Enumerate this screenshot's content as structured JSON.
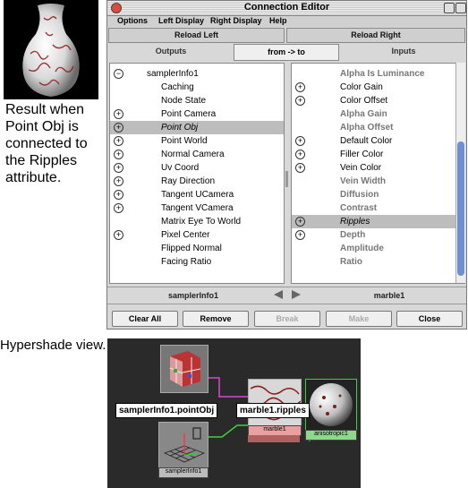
{
  "caption": {
    "lines": [
      "Result when",
      "Point Obj is",
      "connected to",
      "the Ripples",
      "attribute."
    ]
  },
  "window": {
    "title": "Connection Editor",
    "menu": [
      "Options",
      "Left Display",
      "Right Display",
      "Help"
    ],
    "reload_left": "Reload Left",
    "reload_right": "Reload Right",
    "outputs_label": "Outputs",
    "inputs_label": "Inputs",
    "direction_button": "from -> to",
    "left_node": "samplerInfo1",
    "right_node": "marble1",
    "outputs": [
      {
        "label": "samplerInfo1",
        "expander": "minus",
        "indent": 0
      },
      {
        "label": "Caching",
        "expander": "",
        "indent": 1
      },
      {
        "label": "Node State",
        "expander": "",
        "indent": 1
      },
      {
        "label": "Point Camera",
        "expander": "plus",
        "indent": 1
      },
      {
        "label": "Point Obj",
        "expander": "plus",
        "indent": 1,
        "selected": true
      },
      {
        "label": "Point World",
        "expander": "plus",
        "indent": 1
      },
      {
        "label": "Normal Camera",
        "expander": "plus",
        "indent": 1
      },
      {
        "label": "Uv Coord",
        "expander": "plus",
        "indent": 1
      },
      {
        "label": "Ray Direction",
        "expander": "plus",
        "indent": 1
      },
      {
        "label": "Tangent UCamera",
        "expander": "plus",
        "indent": 1
      },
      {
        "label": "Tangent VCamera",
        "expander": "plus",
        "indent": 1
      },
      {
        "label": "Matrix Eye To World",
        "expander": "",
        "indent": 1
      },
      {
        "label": "Pixel Center",
        "expander": "plus",
        "indent": 1
      },
      {
        "label": "Flipped Normal",
        "expander": "",
        "indent": 1
      },
      {
        "label": "Facing Ratio",
        "expander": "",
        "indent": 1
      }
    ],
    "inputs": [
      {
        "label": "Alpha Is Luminance",
        "expander": "",
        "dim": true
      },
      {
        "label": "Color Gain",
        "expander": "plus"
      },
      {
        "label": "Color Offset",
        "expander": "plus"
      },
      {
        "label": "Alpha Gain",
        "expander": "",
        "dim": true
      },
      {
        "label": "Alpha Offset",
        "expander": "",
        "dim": true
      },
      {
        "label": "Default Color",
        "expander": "plus"
      },
      {
        "label": "Filler Color",
        "expander": "plus"
      },
      {
        "label": "Vein Color",
        "expander": "plus"
      },
      {
        "label": "Vein Width",
        "expander": "",
        "dim": true
      },
      {
        "label": "Diffusion",
        "expander": "",
        "dim": true
      },
      {
        "label": "Contrast",
        "expander": "",
        "dim": true
      },
      {
        "label": "Ripples",
        "expander": "plus",
        "selected": true
      },
      {
        "label": "Depth",
        "expander": "plus",
        "dim": true
      },
      {
        "label": "Amplitude",
        "expander": "",
        "dim": true
      },
      {
        "label": "Ratio",
        "expander": "",
        "dim": true
      }
    ],
    "buttons": {
      "clear_all": "Clear All",
      "remove": "Remove",
      "break": "Break",
      "make": "Make",
      "close": "Close"
    }
  },
  "hypershade": {
    "caption": "Hypershade view.",
    "tag_left": "samplerInfo1.pointObj",
    "tag_right": "marble1.ripples",
    "node_marble": "marble1",
    "node_aniso": "anisotropic1",
    "node_sampler": "samplerInfo1",
    "colors": {
      "pink_line": "#d24ad2",
      "green_line": "#3cd23c",
      "marble_label_bg": "#e8a0a0",
      "aniso_label_bg": "#8ed88e"
    }
  }
}
